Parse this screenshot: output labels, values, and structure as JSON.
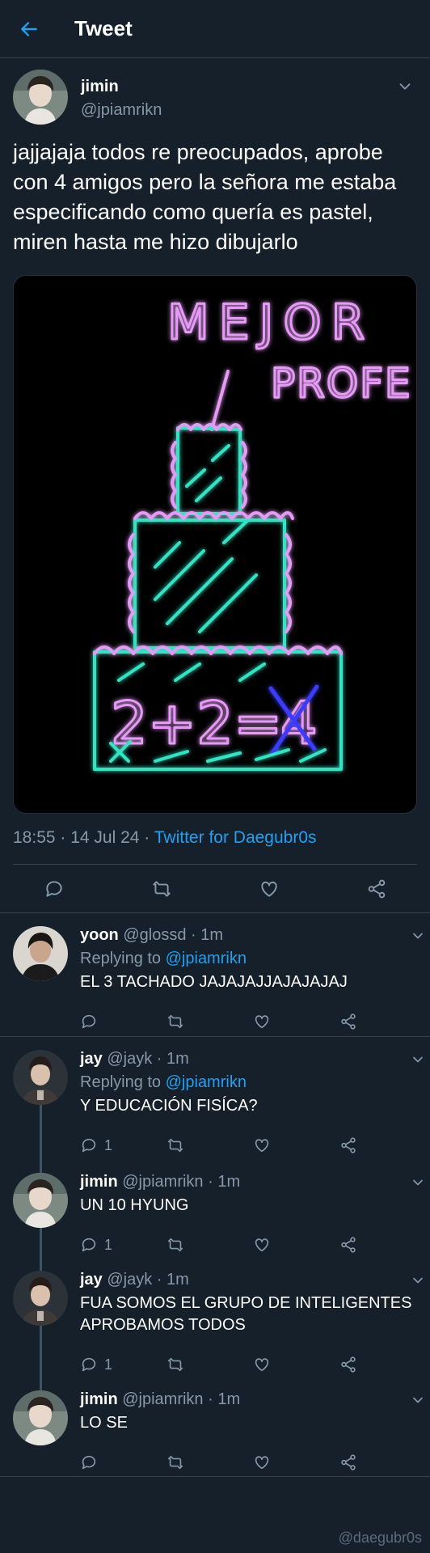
{
  "header": {
    "title": "Tweet"
  },
  "tweet": {
    "name": "jimin",
    "handle": "@jpiamrikn",
    "text": "jajjajaja todos re preocupados, aprobe con 4 amigos pero la señora me estaba especificando como quería es pastel, miren hasta me hizo dibujarlo",
    "image": {
      "kind": "neon drawing of a three-tier birthday cake",
      "caption_line1": "MEJOR",
      "caption_line2": "PROFE",
      "equation": "2+2=",
      "crossed_digit": "4",
      "colors": {
        "text": "#e59af5",
        "cake": "#2ee6c3",
        "cross": "#3b3bff"
      }
    },
    "time": "18:55",
    "date": "14 Jul 24",
    "source": "Twitter for Daegubr0s"
  },
  "replies": [
    {
      "name": "yoon",
      "handle": "@glossd",
      "time": "1m",
      "replying_label": "Replying to",
      "replying_to": "@jpiamrikn",
      "text": "EL 3 TACHADO JAJAJAJJAJAJAJAJ",
      "reply_count": ""
    },
    {
      "name": "jay",
      "handle": "@jayk",
      "time": "1m",
      "replying_label": "Replying to",
      "replying_to": "@jpiamrikn",
      "text": "Y EDUCACIÓN FISÍCA?",
      "reply_count": "1"
    },
    {
      "name": "jimin",
      "handle": "@jpiamrikn",
      "time": "1m",
      "text": "UN 10 HYUNG",
      "reply_count": "1"
    },
    {
      "name": "jay",
      "handle": "@jayk",
      "time": "1m",
      "text": "FUA SOMOS EL GRUPO DE INTELIGENTES APROBAMOS TODOS",
      "reply_count": "1"
    },
    {
      "name": "jimin",
      "handle": "@jpiamrikn",
      "time": "1m",
      "text": "LO SE",
      "reply_count": ""
    }
  ],
  "watermark": "@daegubr0s",
  "colors": {
    "background": "#15202b",
    "accent": "#1da1f2",
    "muted": "#8899a6",
    "divider": "#38444d"
  }
}
